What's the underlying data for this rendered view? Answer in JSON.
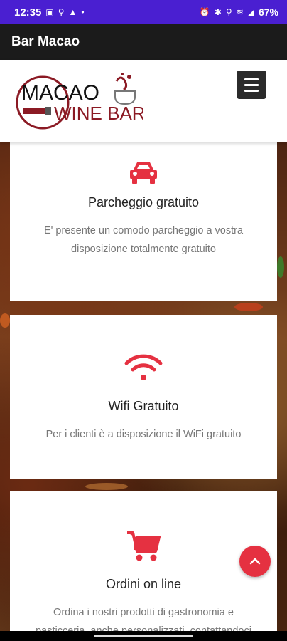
{
  "status": {
    "time": "12:35",
    "battery": "67%"
  },
  "app_bar": {
    "title": "Bar Macao"
  },
  "logo": {
    "line1": "MACAO",
    "line2": "WINE BAR"
  },
  "colors": {
    "accent": "#e53141",
    "app_bar": "#1b1b1b",
    "status_bar": "#4a1fd1"
  },
  "cards": [
    {
      "icon": "car-icon",
      "title": "Parcheggio gratuito",
      "desc": "E' presente un comodo parcheggio a vostra disposizione totalmente gratuito"
    },
    {
      "icon": "wifi-icon",
      "title": "Wifi Gratuito",
      "desc": "Per i clienti è a disposizione il WiFi gratuito"
    },
    {
      "icon": "cart-icon",
      "title": "Ordini on line",
      "desc": "Ordina i nostri prodotti di gastronomia e pasticceria, anche personalizzati, contattandoci"
    }
  ]
}
